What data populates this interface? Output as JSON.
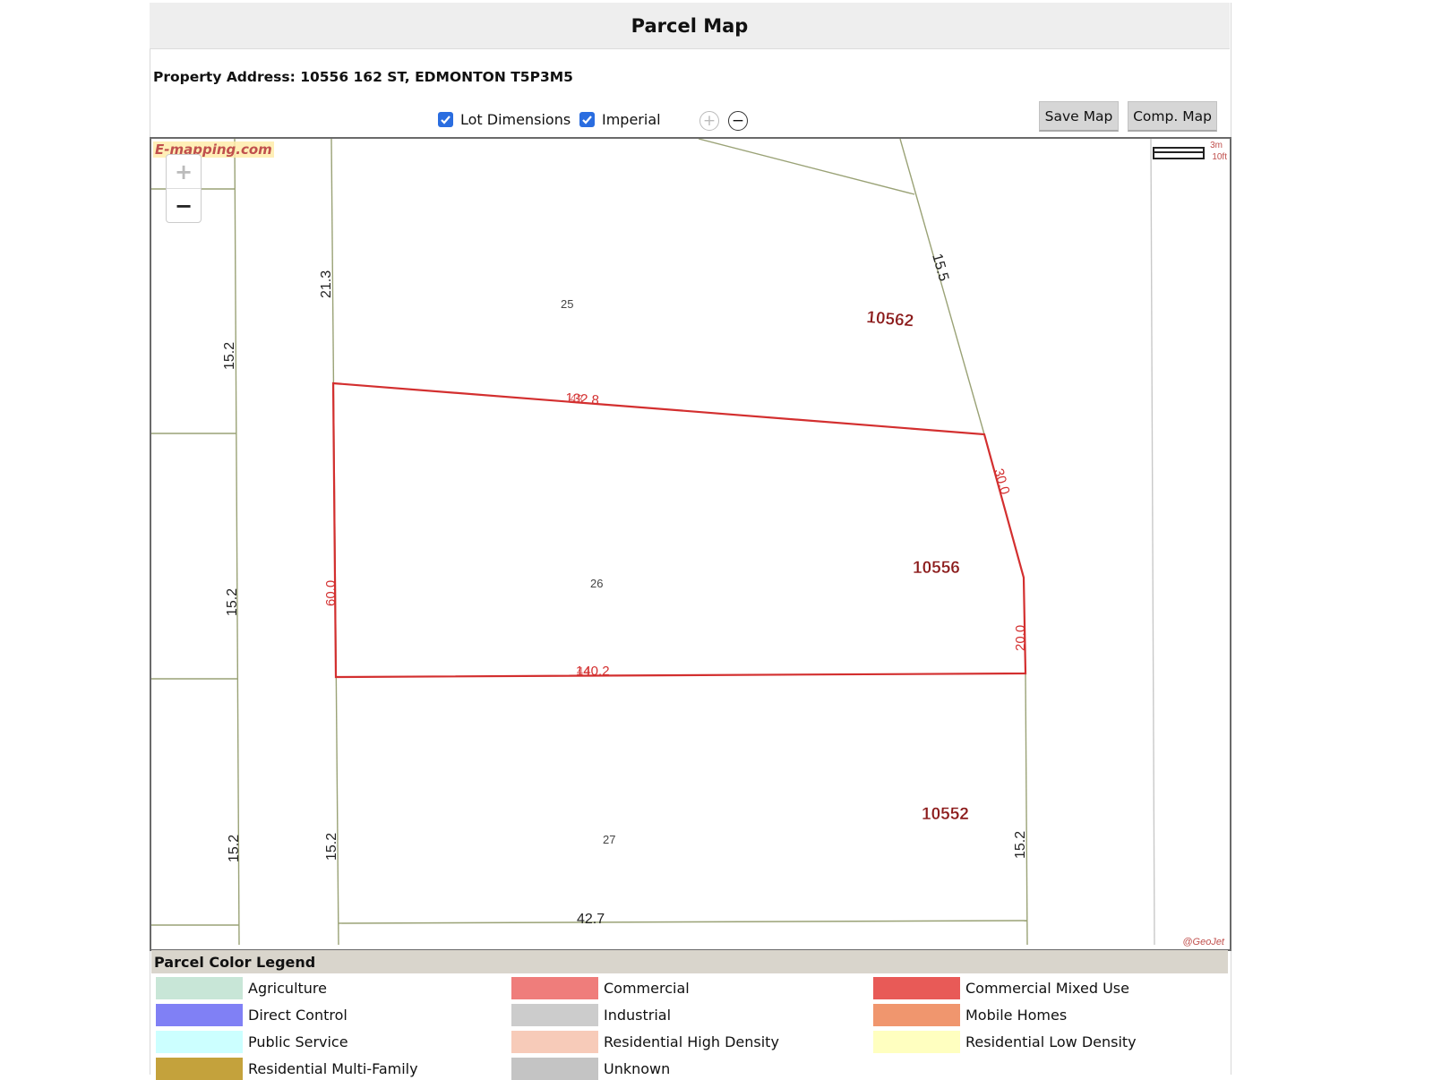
{
  "header": {
    "title": "Parcel Map"
  },
  "property": {
    "address": "Property Address: 10556 162 ST, EDMONTON T5P3M5"
  },
  "toolbar": {
    "lot_dimensions_label": "Lot Dimensions",
    "lot_dimensions_checked": true,
    "imperial_label": "Imperial",
    "imperial_checked": true,
    "save_map_label": "Save Map",
    "comp_map_label": "Comp. Map"
  },
  "map": {
    "watermark": "E-mapping.com",
    "credit": "@GeoJet",
    "scale_m": "3m",
    "scale_ft": "10ft",
    "zoom_in_symbol": "+",
    "zoom_out_symbol": "−",
    "colors": {
      "parcel_line": "#9aa276",
      "selected_parcel": "#d32f2f",
      "address_text": "#8b1a1a"
    },
    "address_labels": [
      "10562",
      "10556",
      "10552"
    ],
    "lot_labels": [
      "25",
      "26",
      "27"
    ],
    "dimension_labels": {
      "left_col_a": "15.2",
      "left_col_b": "15.2",
      "left_col_c": "15.2",
      "lot25_left": "21.3",
      "lot25_right": "15.5",
      "lot27_left": "15.2",
      "lot27_right": "15.2",
      "lot27_bottom": "42.7",
      "sel_top": "132.8",
      "sel_top_overlap": "43",
      "sel_right_upper": "30.0",
      "sel_left": "60.0",
      "sel_right_lower": "20.0",
      "sel_bottom": "140.2",
      "sel_bottom_overlap": "44"
    }
  },
  "legend": {
    "title": "Parcel Color Legend",
    "items": [
      {
        "label": "Agriculture",
        "color": "#c8e6d7"
      },
      {
        "label": "Commercial",
        "color": "#ef7d7b"
      },
      {
        "label": "Commercial Mixed Use",
        "color": "#e85a57"
      },
      {
        "label": "Direct Control",
        "color": "#8080f5"
      },
      {
        "label": "Industrial",
        "color": "#cccccc"
      },
      {
        "label": "Mobile Homes",
        "color": "#f0966e"
      },
      {
        "label": "Public Service",
        "color": "#ccffff"
      },
      {
        "label": "Residential High Density",
        "color": "#f7cbb9"
      },
      {
        "label": "Residential Low Density",
        "color": "#ffffc0"
      },
      {
        "label": "Residential Multi-Family",
        "color": "#c4a23c"
      },
      {
        "label": "Unknown",
        "color": "#c4c4c4"
      }
    ]
  }
}
